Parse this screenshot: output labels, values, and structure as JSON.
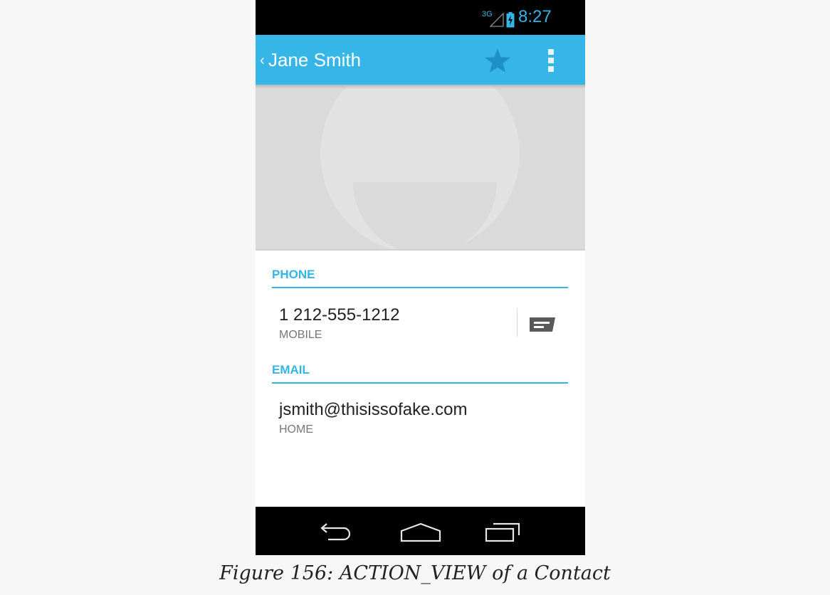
{
  "status_bar": {
    "network": "3G",
    "time": "8:27"
  },
  "action_bar": {
    "up_glyph": "‹",
    "title": "Jane Smith",
    "star_icon": "star-icon",
    "overflow_icon": "overflow-menu-icon"
  },
  "photo": {
    "icon": "default-contact-avatar"
  },
  "phone_section": {
    "header": "PHONE",
    "number": "1 212-555-1212",
    "type": "MOBILE",
    "action_icon": "message-icon"
  },
  "email_section": {
    "header": "EMAIL",
    "address": "jsmith@thisissofake.com",
    "type": "HOME"
  },
  "nav_bar": {
    "back_icon": "back-icon",
    "home_icon": "home-icon",
    "recents_icon": "recent-apps-icon"
  },
  "caption": "Figure 156: ACTION_VIEW of a Contact",
  "colors": {
    "accent": "#33b5e5",
    "action_bar": "#35b6e7",
    "status_bar": "#000000",
    "photo_bg": "#dadada"
  }
}
